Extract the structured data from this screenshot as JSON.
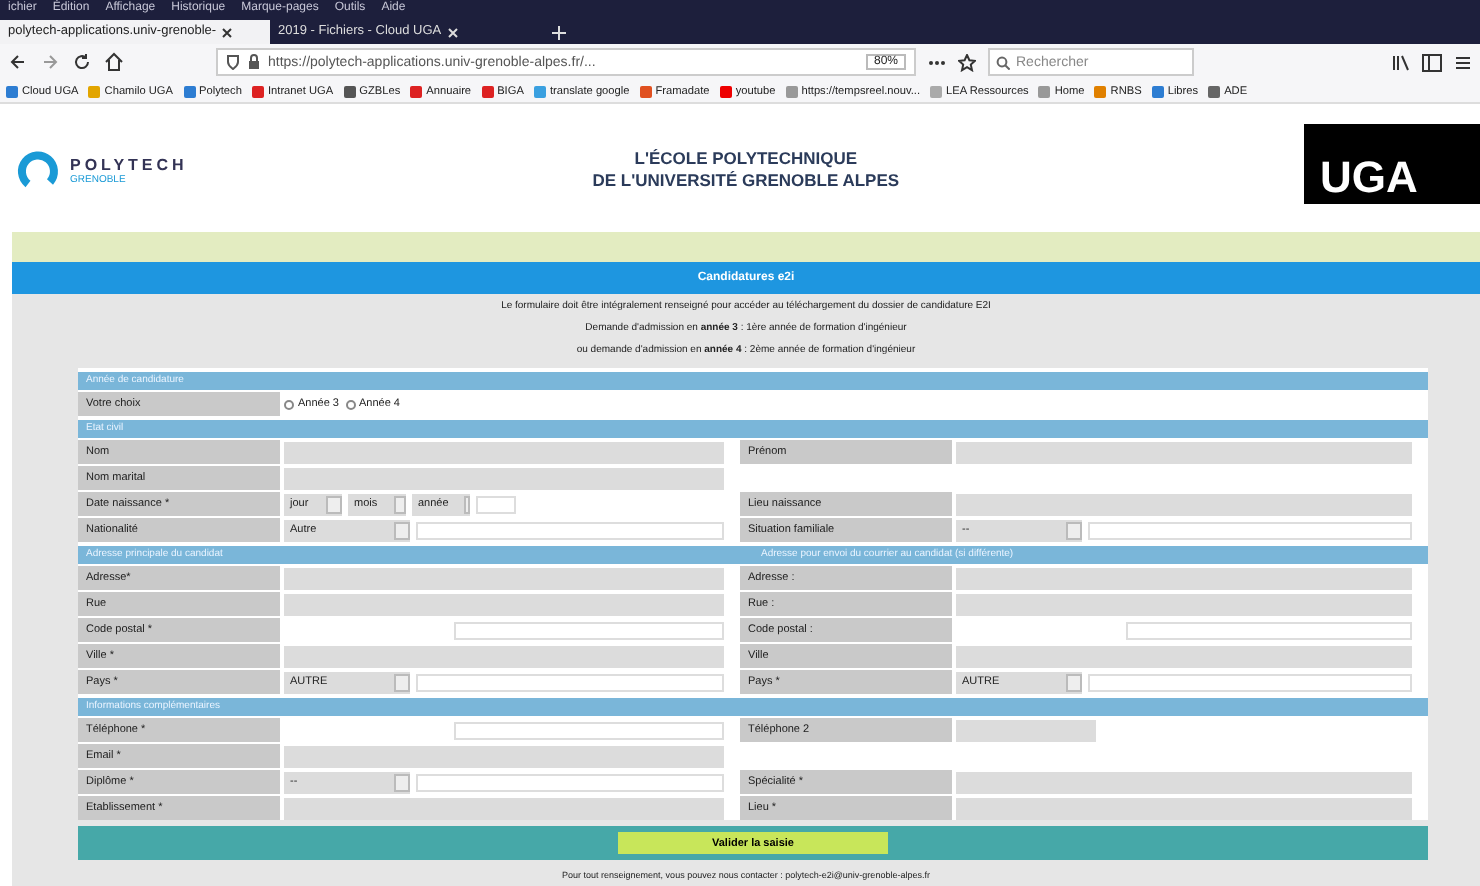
{
  "browser": {
    "menu": [
      "ichier",
      "Édition",
      "Affichage",
      "Historique",
      "Marque-pages",
      "Outils",
      "Aide"
    ],
    "tabs": [
      {
        "label": "polytech-applications.univ-grenoble-",
        "selected": true
      },
      {
        "label": "2019 - Fichiers - Cloud UGA",
        "selected": false
      }
    ],
    "url": "https://polytech-applications.univ-grenoble-alpes.fr/...",
    "zoom": "80%",
    "search": {
      "placeholder": "Rechercher"
    },
    "bookmarks": [
      "Cloud UGA",
      "Chamilo UGA",
      "Polytech",
      "Intranet UGA",
      "GZBLes",
      "Annuaire",
      "BIGA",
      "translate google",
      "Framadate",
      "youtube",
      "https://tempsreel.nouv...",
      "LEA Ressources",
      "Home",
      "RNBS",
      "Libres",
      "ADE"
    ]
  },
  "page": {
    "logo": {
      "name": "POLYTECH",
      "sub": "GRENOBLE"
    },
    "school": [
      "L'ÉCOLE POLYTECHNIQUE",
      "DE L'UNIVERSITÉ GRENOBLE ALPES"
    ],
    "uga": "UGA",
    "banner": "Candidatures e2i",
    "intro": [
      "Le formulaire doit être intégralement renseigné pour accéder au téléchargement du dossier de candidature E2I",
      "Demande d'admission en **année 3** : 1ère année de formation d'ingénieur",
      "ou demande d'admission en **année 4** : 2ème année de formation d'ingénieur"
    ],
    "sections": [
      {
        "headers": [
          "Année de candidature"
        ],
        "rows": [
          {
            "left": {
              "label": "Votre choix",
              "field": {
                "kind": "radios",
                "options": [
                  {
                    "label": "Année 3",
                    "selected": false
                  },
                  {
                    "label": "Année 4",
                    "selected": false
                  }
                ]
              }
            }
          }
        ]
      },
      {
        "headers": [
          "Etat civil"
        ],
        "rows": [
          {
            "left": {
              "label": "Nom",
              "field": {
                "kind": "text"
              }
            },
            "right": {
              "label": "Prénom",
              "field": {
                "kind": "text"
              }
            }
          },
          {
            "left": {
              "label": "Nom marital",
              "field": {
                "kind": "text"
              }
            }
          },
          {
            "left": {
              "label": "Date naissance *",
              "field": {
                "kind": "date",
                "parts": [
                  "jour",
                  "mois",
                  "année"
                ]
              }
            },
            "right": {
              "label": "Lieu naissance",
              "field": {
                "kind": "text"
              }
            }
          },
          {
            "left": {
              "label": "Nationalité",
              "field": {
                "kind": "select",
                "value": "Autre"
              }
            },
            "right": {
              "label": "Situation familiale",
              "field": {
                "kind": "select",
                "value": "--"
              }
            }
          }
        ]
      },
      {
        "headers": [
          "Adresse principale du candidat",
          "Adresse pour envoi du courrier au candidat (si différente)"
        ],
        "rows": [
          {
            "left": {
              "label": "Adresse*",
              "field": {
                "kind": "text"
              }
            },
            "right": {
              "label": "Adresse :",
              "field": {
                "kind": "text"
              }
            }
          },
          {
            "left": {
              "label": "Rue",
              "field": {
                "kind": "text"
              }
            },
            "right": {
              "label": "Rue :",
              "field": {
                "kind": "text"
              }
            }
          },
          {
            "left": {
              "label": "Code postal *",
              "field": {
                "kind": "short"
              }
            },
            "right": {
              "label": "Code postal :",
              "field": {
                "kind": "short"
              }
            }
          },
          {
            "left": {
              "label": "Ville *",
              "field": {
                "kind": "text"
              }
            },
            "right": {
              "label": "Ville",
              "field": {
                "kind": "text"
              }
            }
          },
          {
            "left": {
              "label": "Pays *",
              "field": {
                "kind": "select",
                "value": "AUTRE"
              }
            },
            "right": {
              "label": "Pays *",
              "field": {
                "kind": "select",
                "value": "AUTRE"
              }
            }
          }
        ]
      },
      {
        "headers": [
          "Informations complémentaires"
        ],
        "rows": [
          {
            "left": {
              "label": "Téléphone *",
              "field": {
                "kind": "short"
              }
            },
            "right": {
              "label": "Téléphone 2",
              "field": {
                "kind": "small"
              }
            }
          },
          {
            "left": {
              "label": "Email *",
              "field": {
                "kind": "text"
              }
            }
          },
          {
            "left": {
              "label": "Diplôme *",
              "field": {
                "kind": "select",
                "value": "--"
              }
            },
            "right": {
              "label": "Spécialité *",
              "field": {
                "kind": "text"
              }
            }
          },
          {
            "left": {
              "label": "Etablissement *",
              "field": {
                "kind": "text"
              }
            },
            "right": {
              "label": "Lieu *",
              "field": {
                "kind": "text"
              }
            }
          }
        ]
      }
    ],
    "submit": "Valider la saisie",
    "footer": "Pour tout renseignement, vous pouvez nous contacter : polytech-e2i@univ-grenoble-alpes.fr"
  }
}
